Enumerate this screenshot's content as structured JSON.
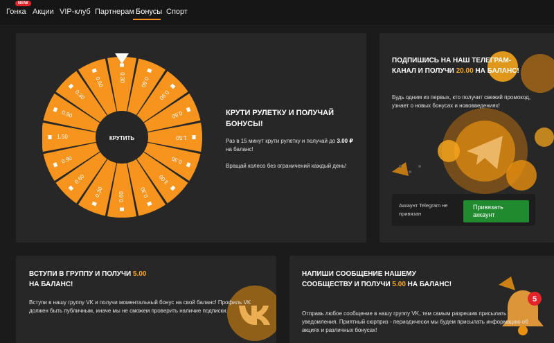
{
  "nav": {
    "items": [
      "Гонка",
      "Акции",
      "VIP-клуб",
      "Партнерам",
      "Бонусы",
      "Спорт"
    ],
    "badge": "NEW",
    "active": "Бонусы"
  },
  "wheel": {
    "center_button": "КРУТИТЬ",
    "segments": [
      "0.30",
      "0.60",
      "0.90",
      "0.60",
      "1.50",
      "0.30",
      "3.00",
      "0.30",
      "0.60",
      "0.30",
      "0.60",
      "0.90",
      "1.50",
      "0.90",
      "0.30",
      "0.60"
    ],
    "title": "КРУТИ РУЛЕТКУ И ПОЛУЧАЙ БОНУСЫ!",
    "desc_prefix": "Раз в 15 минут крути рулетку и получай до",
    "desc_amount": "3.00 ₽",
    "desc_suffix": "на баланс!",
    "note": "Вращай колесо без ограничений каждый день!"
  },
  "telegram": {
    "title_prefix": "ПОДПИШИСЬ НА НАШ ТЕЛЕГРАМ-КАНАЛ И ПОЛУЧИ",
    "amount": "20.00",
    "title_suffix": "НА БАЛАНС!",
    "desc": "Будь одним из первых, кто получит свежий промокод, узнает о новых бонусах и нововведениях!",
    "status": "Аккаунт Telegram не привязан",
    "button": "Привязать аккаунт"
  },
  "vk": {
    "title_prefix": "ВСТУПИ В ГРУППУ И ПОЛУЧИ",
    "amount": "5.00",
    "title_suffix": "НА БАЛАНС!",
    "desc": "Вступи в нашу группу VK и получи моментальный бонус на свой баланс! Профиль VK должен быть публичным, иначе мы не сможем проверить наличие подписки."
  },
  "message": {
    "title_prefix": "НАПИШИ СООБЩЕНИЕ НАШЕМУ СООБЩЕСТВУ И ПОЛУЧИ",
    "amount": "5.00",
    "title_suffix": "НА БАЛАНС!",
    "desc": "Отправь любое сообщение в нашу группу VK, тем самым разрешив присылать уведомления. Приятный сюрприз - периодически мы будем присылать информацию об акциях и различных бонусах!",
    "bell_badge": "5"
  },
  "colors": {
    "accent": "#f7941d",
    "green": "#1f8a2e",
    "panel": "#272727"
  }
}
